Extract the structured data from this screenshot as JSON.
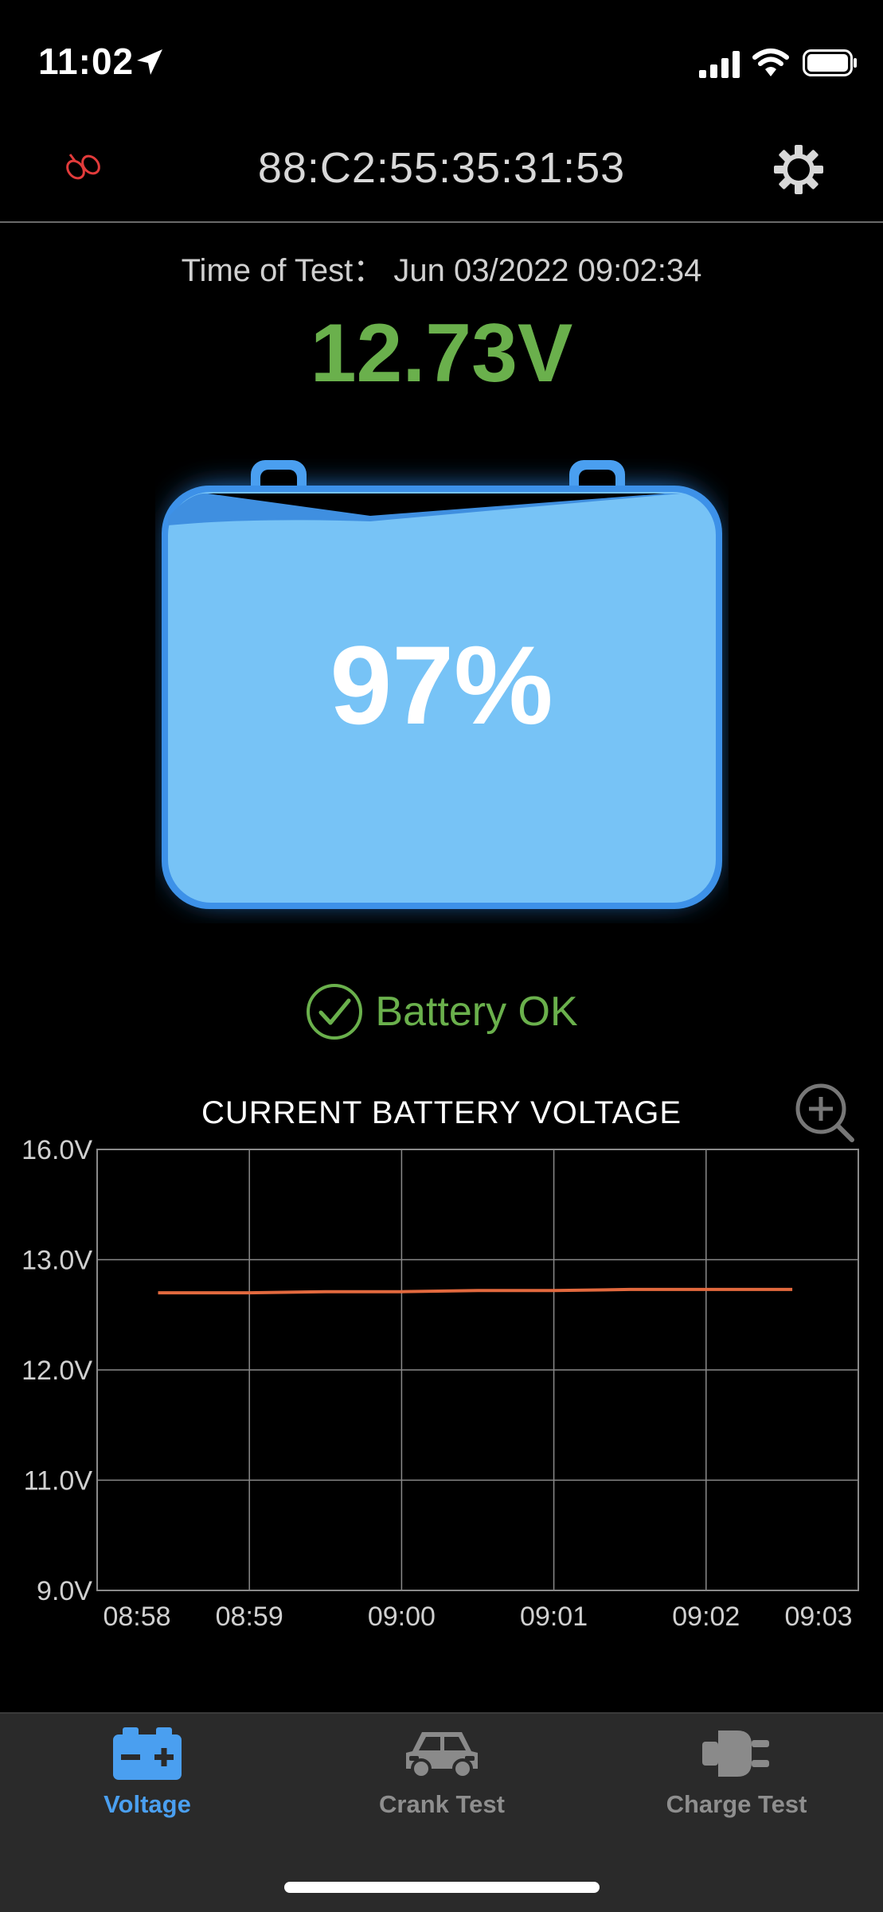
{
  "status_bar": {
    "time": "11:02"
  },
  "nav": {
    "title": "88:C2:55:35:31:53"
  },
  "test": {
    "time_label": "Time of Test：",
    "time_value": "Jun 03/2022 09:02:34",
    "voltage": "12.73V",
    "percent": "97%",
    "status": "Battery OK"
  },
  "colors": {
    "good": "#6ab04c",
    "accent": "#4a9ff0",
    "battery_fill": "#77c3f6",
    "series": "#e2693e"
  },
  "chart_data": {
    "type": "line",
    "title": "CURRENT BATTERY VOLTAGE",
    "y_tick_labels": [
      "16.0V",
      "13.0V",
      "12.0V",
      "11.0V",
      "9.0V"
    ],
    "x_tick_labels": [
      "08:58",
      "08:59",
      "09:00",
      "09:01",
      "09:02",
      "09:03"
    ],
    "grid": true,
    "series": [
      {
        "x": [
          "08:58:24",
          "08:59:00",
          "08:59:30",
          "09:00:00",
          "09:00:30",
          "09:01:00",
          "09:01:30",
          "09:02:00",
          "09:02:34"
        ],
        "y": [
          12.7,
          12.7,
          12.71,
          12.71,
          12.72,
          12.72,
          12.73,
          12.73,
          12.73
        ]
      }
    ]
  },
  "tabs": [
    {
      "label": "Voltage",
      "icon": "battery-icon",
      "active": true
    },
    {
      "label": "Crank Test",
      "icon": "car-icon",
      "active": false
    },
    {
      "label": "Charge Test",
      "icon": "plug-icon",
      "active": false
    }
  ]
}
